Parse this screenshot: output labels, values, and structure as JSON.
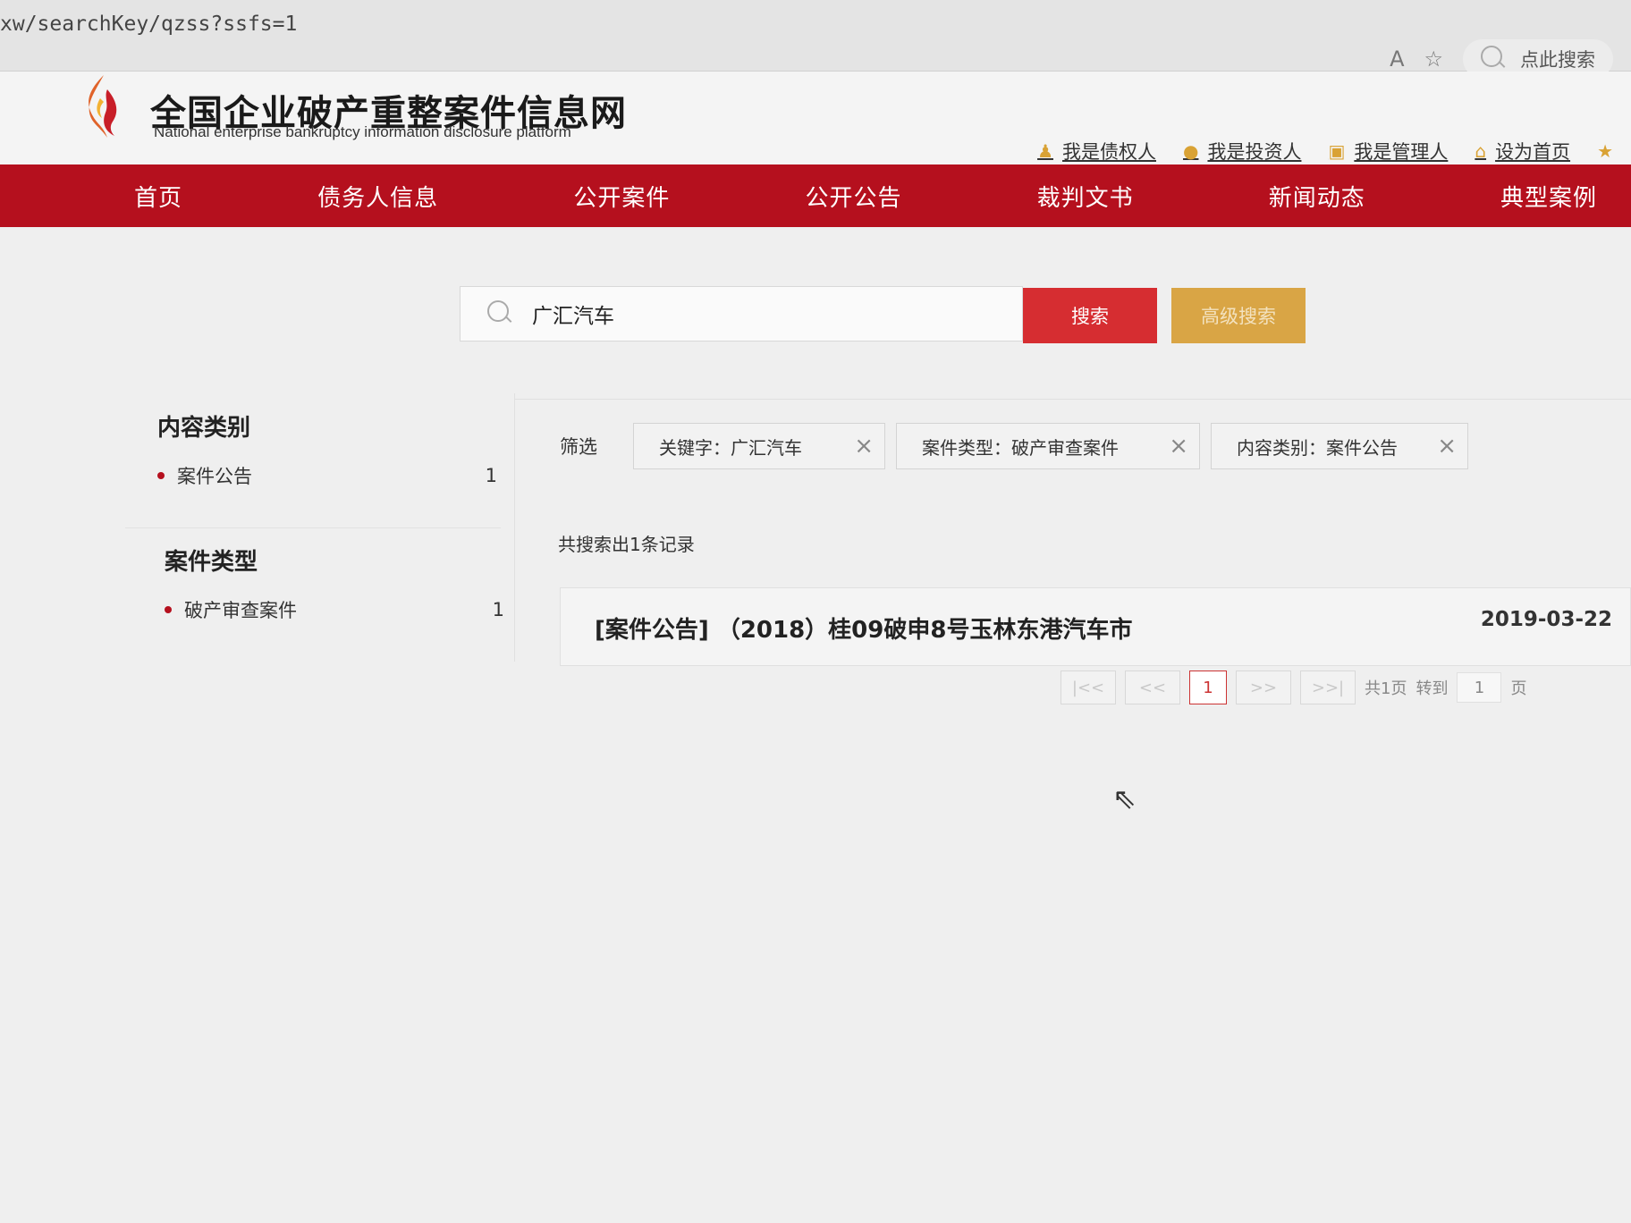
{
  "browser": {
    "url": "xw/searchKey/qzss?ssfs=1",
    "read_aloud_icon": "A",
    "favorite_icon": "☆",
    "search_placeholder": "点此搜索"
  },
  "site": {
    "title": "全国企业破产重整案件信息网",
    "subtitle": "National enterprise bankruptcy information disclosure platform",
    "header_links": [
      {
        "label": "我是债权人",
        "icon": "person-icon"
      },
      {
        "label": "我是投资人",
        "icon": "coin-icon"
      },
      {
        "label": "我是管理人",
        "icon": "manager-icon"
      },
      {
        "label": "设为首页",
        "icon": "home-icon"
      }
    ]
  },
  "nav": [
    "首页",
    "债务人信息",
    "公开案件",
    "公开公告",
    "裁判文书",
    "新闻动态",
    "典型案例"
  ],
  "search": {
    "value": "广汇汽车",
    "search_label": "搜索",
    "advanced_label": "高级搜索"
  },
  "sidebar": {
    "content_category": {
      "title": "内容类别",
      "items": [
        {
          "label": "案件公告",
          "count": "1"
        }
      ]
    },
    "case_type": {
      "title": "案件类型",
      "items": [
        {
          "label": "破产审查案件",
          "count": "1"
        }
      ]
    }
  },
  "filters": {
    "label": "筛选",
    "chips": [
      "关键字：广汇汽车",
      "案件类型：破产审查案件",
      "内容类别：案件公告"
    ],
    "remove_icon": "×"
  },
  "results": {
    "count_text": "共搜索出1条记录",
    "items": [
      {
        "title": "[案件公告] （2018）桂09破申8号玉林东港汽车市",
        "date": "2019-03-22"
      }
    ]
  },
  "pagination": {
    "first": "|<<",
    "prev": "<<",
    "current": "1",
    "next": ">>",
    "last": ">>|",
    "total_text": "共1页",
    "goto_text": "转到",
    "goto_value": "1",
    "page_suffix": "页"
  },
  "colors": {
    "brand_red": "#b5101e",
    "search_red": "#d62d31",
    "advanced_gold": "#d9a545"
  }
}
